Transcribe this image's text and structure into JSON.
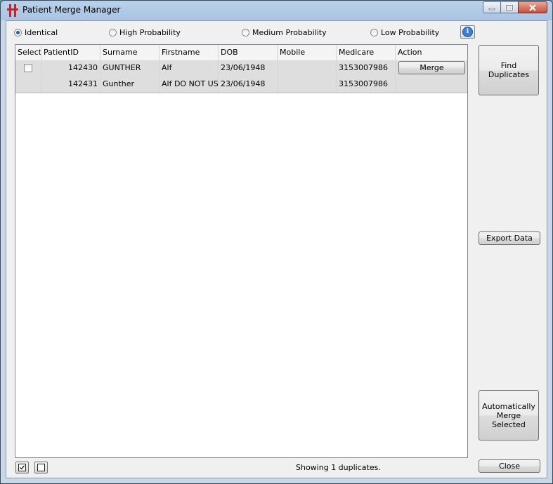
{
  "window": {
    "title": "Patient Merge Manager"
  },
  "filters": [
    {
      "label": "Identical",
      "selected": true
    },
    {
      "label": "High Probability",
      "selected": false
    },
    {
      "label": "Medium Probability",
      "selected": false
    },
    {
      "label": "Low Probability",
      "selected": false
    }
  ],
  "table": {
    "columns": [
      "Select",
      "PatientID",
      "Surname",
      "Firstname",
      "DOB",
      "Mobile",
      "Medicare",
      "Action"
    ],
    "rows": [
      {
        "select": false,
        "patient_id": "142430",
        "surname": "GUNTHER",
        "firstname": "Alf",
        "dob": "23/06/1948",
        "mobile": "",
        "medicare": "3153007986",
        "action": "Merge"
      },
      {
        "patient_id": "142431",
        "surname": "Gunther",
        "firstname": "Alf DO NOT USE",
        "dob": "23/06/1948",
        "mobile": "",
        "medicare": "3153007986",
        "action": ""
      }
    ]
  },
  "buttons": {
    "find_duplicates": "Find Duplicates",
    "export_data": "Export Data",
    "auto_merge": "Automatically Merge Selected",
    "close": "Close"
  },
  "status": "Showing 1 duplicates."
}
